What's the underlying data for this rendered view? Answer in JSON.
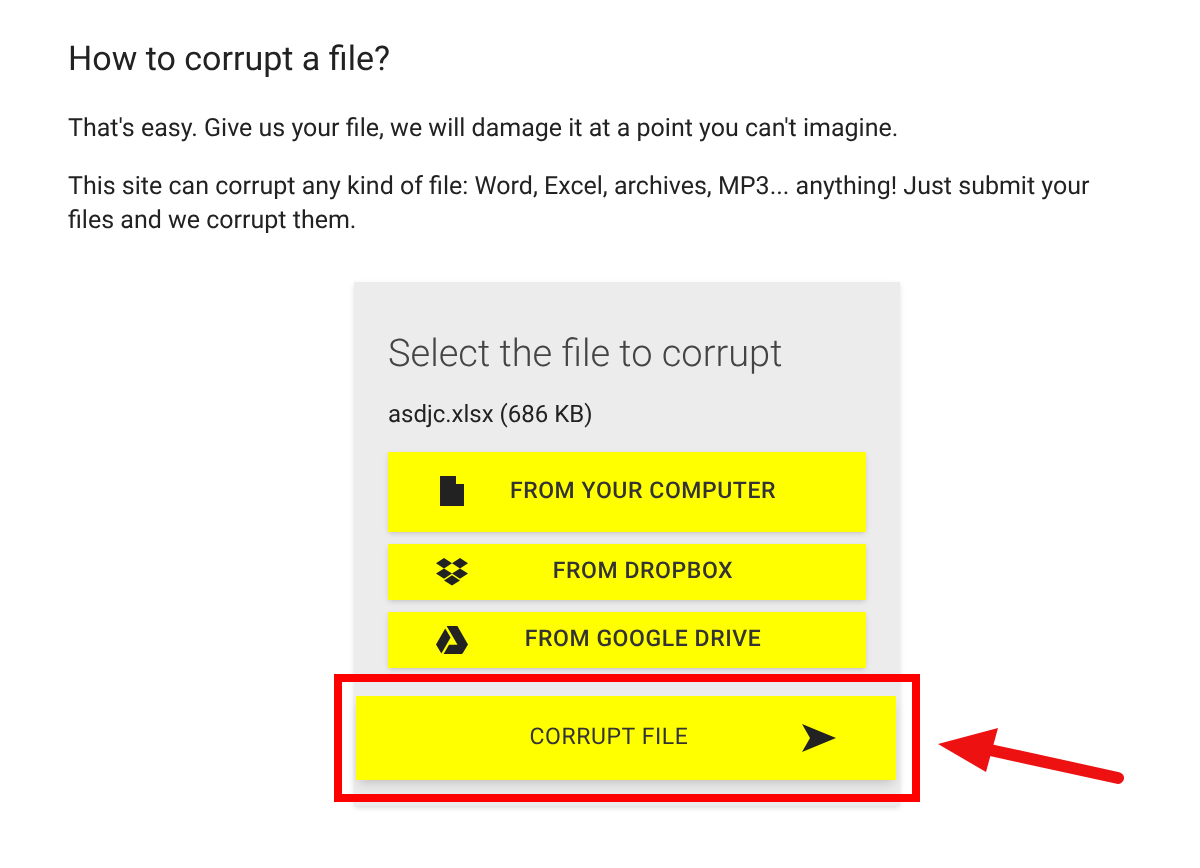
{
  "heading": "How to corrupt a file?",
  "paragraphs": [
    "That's easy. Give us your file, we will damage it at a point you can't imagine.",
    "This site can corrupt any kind of file: Word, Excel, archives, MP3... anything! Just submit your files and we corrupt them."
  ],
  "card": {
    "title": "Select the file to corrupt",
    "file": "asdjc.xlsx (686 KB)",
    "sources": [
      {
        "kind": "file",
        "label": "FROM YOUR COMPUTER"
      },
      {
        "kind": "dropbox",
        "label": "FROM DROPBOX"
      },
      {
        "kind": "drive",
        "label": "FROM GOOGLE DRIVE"
      }
    ],
    "submit": {
      "label": "CORRUPT FILE",
      "highlighted": true
    }
  }
}
